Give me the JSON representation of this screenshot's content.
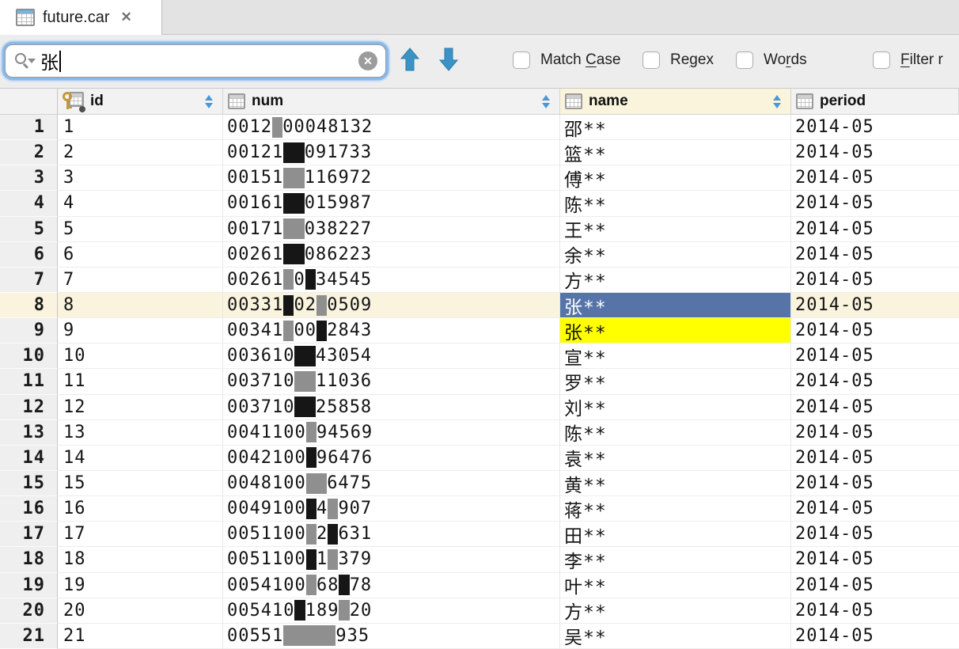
{
  "tab": {
    "title": "future.car",
    "close_glyph": "✕"
  },
  "search": {
    "query": "张",
    "clear_glyph": "✕",
    "options": [
      {
        "key": "match-case",
        "pre": "Match ",
        "mn": "C",
        "post": "ase"
      },
      {
        "key": "regex",
        "pre": "Re",
        "mn": "g",
        "post": "ex"
      },
      {
        "key": "words",
        "pre": "Wo",
        "mn": "r",
        "post": "ds"
      },
      {
        "key": "filter",
        "pre": "",
        "mn": "F",
        "post": "ilter r"
      }
    ]
  },
  "table": {
    "columns": [
      {
        "key": "id",
        "label": "id",
        "primary": true,
        "sortable": true,
        "header_highlighted": false
      },
      {
        "key": "num",
        "label": "num",
        "primary": false,
        "sortable": true,
        "header_highlighted": false
      },
      {
        "key": "name",
        "label": "name",
        "primary": false,
        "sortable": true,
        "header_highlighted": true
      },
      {
        "key": "period",
        "label": "period",
        "primary": false,
        "sortable": false,
        "header_highlighted": false
      }
    ],
    "selection": {
      "row": "8",
      "column": "name"
    },
    "find_match": {
      "row": "9",
      "column": "name"
    },
    "rows": [
      {
        "n": "1",
        "id": "1",
        "num": "0012#00048132",
        "name": "邵**",
        "period": "2014-05"
      },
      {
        "n": "2",
        "id": "2",
        "num": "00121##091733",
        "name": "篮**",
        "period": "2014-05"
      },
      {
        "n": "3",
        "id": "3",
        "num": "00151##116972",
        "name": "傅**",
        "period": "2014-05"
      },
      {
        "n": "4",
        "id": "4",
        "num": "00161##015987",
        "name": "陈**",
        "period": "2014-05"
      },
      {
        "n": "5",
        "id": "5",
        "num": "00171##038227",
        "name": "王**",
        "period": "2014-05"
      },
      {
        "n": "6",
        "id": "6",
        "num": "00261##086223",
        "name": "余**",
        "period": "2014-05"
      },
      {
        "n": "7",
        "id": "7",
        "num": "00261#0#34545",
        "name": "方**",
        "period": "2014-05"
      },
      {
        "n": "8",
        "id": "8",
        "num": "00331#02#0509",
        "name": "张**",
        "period": "2014-05"
      },
      {
        "n": "9",
        "id": "9",
        "num": "00341#00#2843",
        "name": "张**",
        "period": "2014-05"
      },
      {
        "n": "10",
        "id": "10",
        "num": "003610##43054",
        "name": "宣**",
        "period": "2014-05"
      },
      {
        "n": "11",
        "id": "11",
        "num": "003710##11036",
        "name": "罗**",
        "period": "2014-05"
      },
      {
        "n": "12",
        "id": "12",
        "num": "003710##25858",
        "name": "刘**",
        "period": "2014-05"
      },
      {
        "n": "13",
        "id": "13",
        "num": "0041100#94569",
        "name": "陈**",
        "period": "2014-05"
      },
      {
        "n": "14",
        "id": "14",
        "num": "0042100#96476",
        "name": "袁**",
        "period": "2014-05"
      },
      {
        "n": "15",
        "id": "15",
        "num": "0048100##6475",
        "name": "黄**",
        "period": "2014-05"
      },
      {
        "n": "16",
        "id": "16",
        "num": "0049100#4#907",
        "name": "蒋**",
        "period": "2014-05"
      },
      {
        "n": "17",
        "id": "17",
        "num": "0051100#2#631",
        "name": "田**",
        "period": "2014-05"
      },
      {
        "n": "18",
        "id": "18",
        "num": "0051100#1#379",
        "name": "李**",
        "period": "2014-05"
      },
      {
        "n": "19",
        "id": "19",
        "num": "0054100#68#78",
        "name": "叶**",
        "period": "2014-05"
      },
      {
        "n": "20",
        "id": "20",
        "num": "005410#189#20",
        "name": "方**",
        "period": "2014-05"
      },
      {
        "n": "21",
        "id": "21",
        "num": "00551#####935",
        "name": "吴**",
        "period": "2014-05"
      }
    ]
  },
  "colors": {
    "selection_blue": "#5674A8",
    "match_yellow": "#FFFF00",
    "current_row_cream": "#FAF4DE",
    "header_highlight_cream": "#FAF4DC",
    "nav_arrow_blue": "#3B93C5",
    "sort_arrow_blue": "#4E97D1",
    "primary_key_gold": "#C4973C"
  }
}
